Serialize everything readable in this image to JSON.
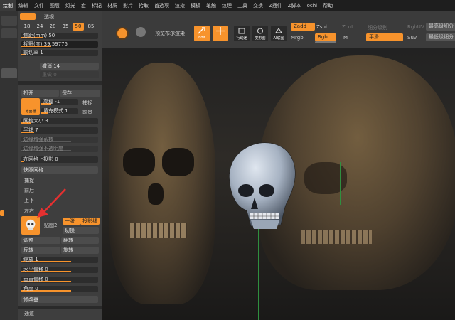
{
  "menubar": {
    "items": [
      "绘制",
      "编辑",
      "文件",
      "图层",
      "灯光",
      "宏",
      "标记",
      "材质",
      "影片",
      "拾取",
      "首选项",
      "渲染",
      "模板",
      "笔触",
      "纹理",
      "工具",
      "变换",
      "Z插件",
      "Z脚本",
      "ochi",
      "帮助"
    ]
  },
  "camera_panel": {
    "perspective_label": "透视",
    "perspective_btn": "",
    "fov_tabs": [
      "18",
      "24",
      "28",
      "35",
      "50",
      "85"
    ],
    "selected_fov": "50",
    "focal_length": "焦距(mm) 50",
    "fov": "视野(度)  39.59775",
    "near_clip": "前切率 1",
    "undo": "撤消 14",
    "redo": "重做 0"
  },
  "texture_panel": {
    "open": "打开",
    "save": "保存",
    "grid_button": "地面栅",
    "height": "高程 -1",
    "capture": "捕捉",
    "fill_mode": "填充模式 1",
    "front": "前景",
    "grid_size": "网格大小 3",
    "tile": "平铺 7",
    "edge_dark_coef": "边缘增强系数",
    "edge_dark_opacity": "边缘增强不透明度",
    "grid_projection": "在网格上投影 0",
    "quick_grid": "快照网格",
    "capture2": "捕捉",
    "front_back": "前后",
    "up_down": "上下",
    "left_right": "左右",
    "map_label": "贴图2",
    "single": "一张",
    "projection_line": "投影线",
    "switch": "切换",
    "adjust": "调整",
    "flip": "翻转",
    "invert": "反转",
    "rotate": "旋转",
    "zoom": "缩放 1",
    "h_offset": "水平偏移 0",
    "v_offset": "垂直偏移 0",
    "angle": "角度 0",
    "modifier": "修改器",
    "channel": "通道"
  },
  "toolbar": {
    "preview_render": "预览布尔渲染",
    "edit": "Edit",
    "move": "",
    "btn3": "行动迷",
    "btn4": "变形图",
    "btn5": "AI联图",
    "zadd": "Zadd",
    "zsub": "Zsub",
    "zcut": "Zcut",
    "mrgb": "Mrgb",
    "rgb": "Rgb",
    "m": "M",
    "smooth_label": "细分级别",
    "smooth_value": "平滑",
    "rgbuv": "RgbUV",
    "suv": "Suv",
    "lowest": "最高级细分",
    "lowest2": "最低级细分"
  },
  "colors": {
    "accent": "#f7932c",
    "panel": "#3e3e3e",
    "menubar": "#1e1e1e",
    "axis_green": "#2f8f3f",
    "annotation_red": "#e53030"
  }
}
